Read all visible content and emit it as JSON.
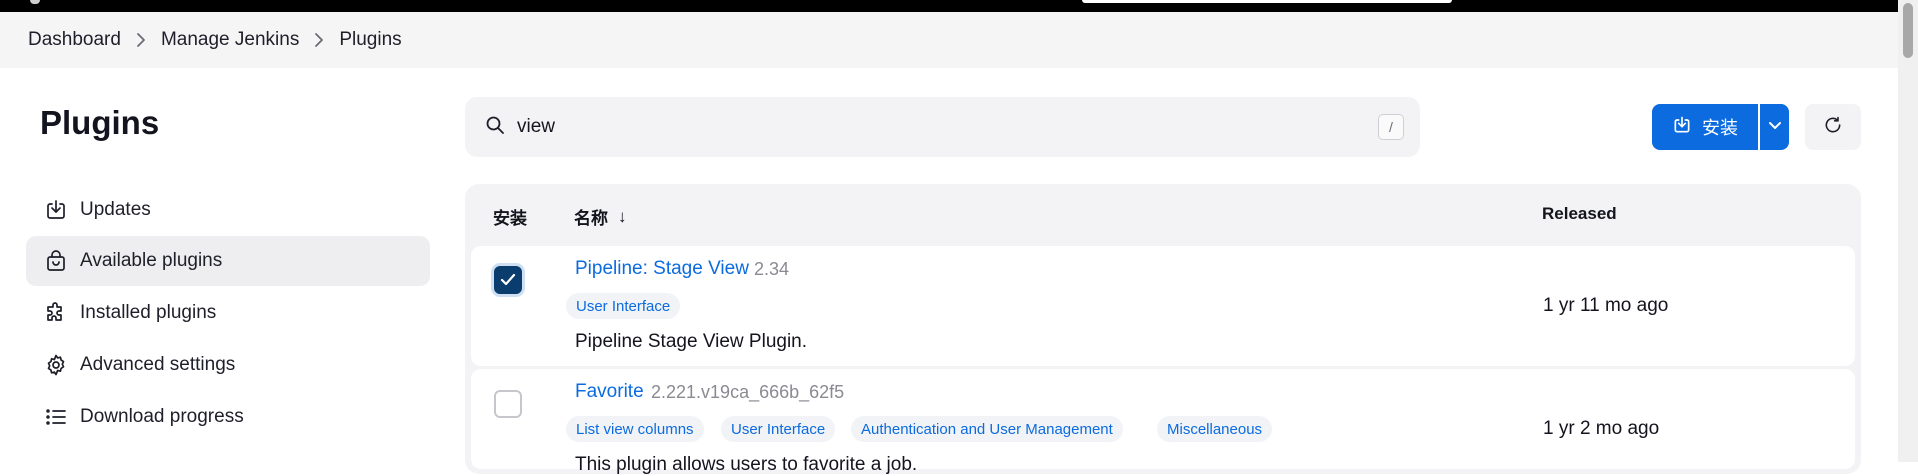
{
  "breadcrumbs": [
    "Dashboard",
    "Manage Jenkins",
    "Plugins"
  ],
  "page_title": "Plugins",
  "sidebar": {
    "items": [
      {
        "label": "Updates",
        "icon": "download-icon",
        "active": false
      },
      {
        "label": "Available plugins",
        "icon": "shopping-bag-icon",
        "active": true
      },
      {
        "label": "Installed plugins",
        "icon": "puzzle-icon",
        "active": false
      },
      {
        "label": "Advanced settings",
        "icon": "gear-icon",
        "active": false
      },
      {
        "label": "Download progress",
        "icon": "list-icon",
        "active": false
      }
    ]
  },
  "search": {
    "value": "view",
    "shortcut": "/"
  },
  "toolbar": {
    "install_label": "安装"
  },
  "table": {
    "headers": {
      "install": "安装",
      "name": "名称",
      "sort_indicator": "↓",
      "released": "Released"
    },
    "rows": [
      {
        "checked": true,
        "name": "Pipeline: Stage View",
        "version": "2.34",
        "tags": [
          "User Interface"
        ],
        "description": "Pipeline Stage View Plugin.",
        "released": "1 yr 11 mo ago"
      },
      {
        "checked": false,
        "name": "Favorite",
        "version": "2.221.v19ca_666b_62f5",
        "tags": [
          "List view columns",
          "User Interface",
          "Authentication and User Management",
          "Miscellaneous"
        ],
        "description": "This plugin allows users to favorite a job.",
        "released": "1 yr 2 mo ago"
      }
    ]
  },
  "colors": {
    "accent": "#0b6bdf",
    "checkbox_checked": "#0a3d6e",
    "surface": "#f3f3f5"
  }
}
